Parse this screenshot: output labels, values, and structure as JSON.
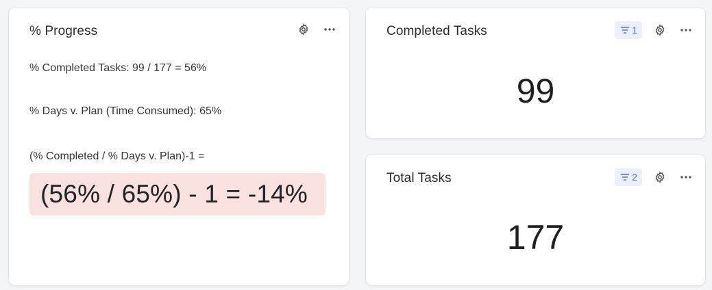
{
  "progress_card": {
    "title": "% Progress",
    "line_completed": "% Completed Tasks: 99 / 177 = 56%",
    "line_days": "% Days v. Plan (Time Consumed): 65%",
    "line_formula": "(% Completed / % Days v. Plan)-1 =",
    "highlight_result": "(56% / 65%) - 1 = -14%",
    "highlight_color": "#f8e1de",
    "icons": [
      "gear-icon",
      "more-icon"
    ]
  },
  "completed_card": {
    "title": "Completed Tasks",
    "filter_count": "1",
    "value": "99",
    "icons": [
      "filter-icon",
      "gear-icon",
      "more-icon"
    ]
  },
  "total_card": {
    "title": "Total Tasks",
    "filter_count": "2",
    "value": "177",
    "icons": [
      "filter-icon",
      "gear-icon",
      "more-icon"
    ]
  },
  "colors": {
    "filter_badge_bg": "#eceffd",
    "filter_badge_fg": "#5b6cd9",
    "page_bg": "#f4f5f7"
  }
}
